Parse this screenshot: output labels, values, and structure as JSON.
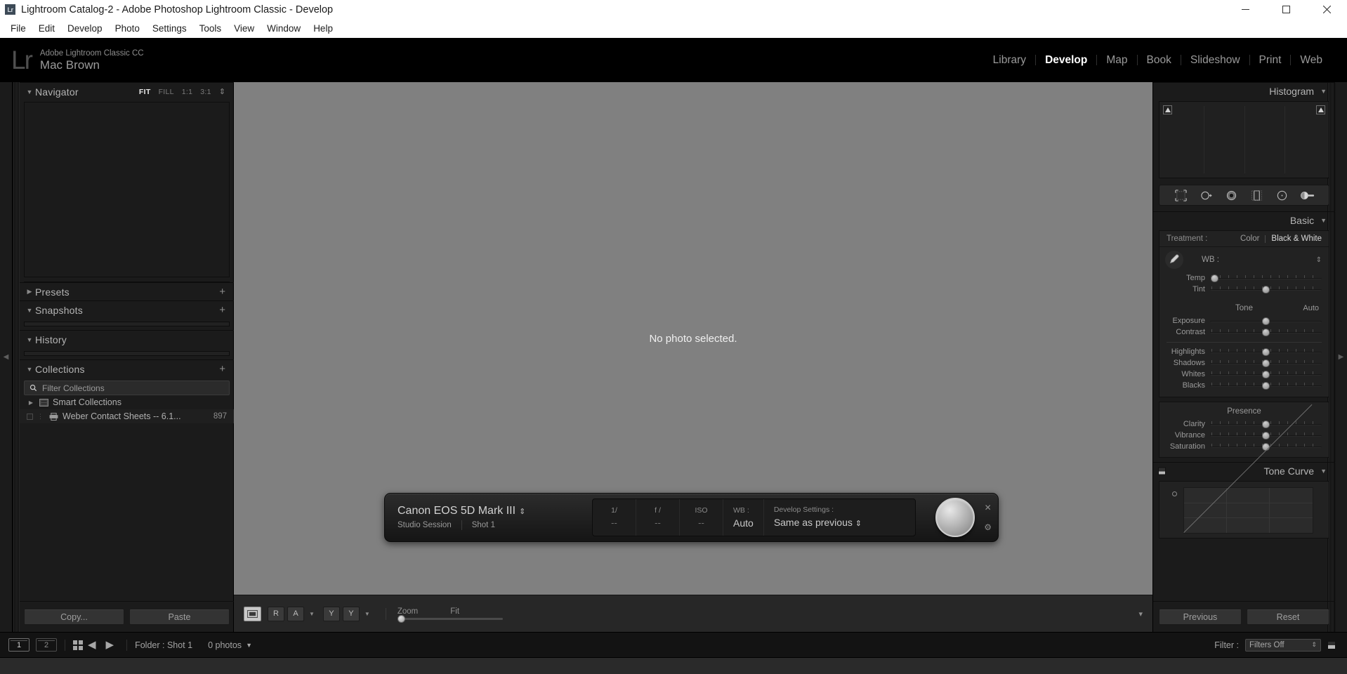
{
  "titlebar": {
    "icon": "lr-app-icon",
    "icon_text": "Lr",
    "title": "Lightroom Catalog-2 - Adobe Photoshop Lightroom Classic - Develop",
    "minimize": "minimize-icon",
    "maximize": "maximize-icon",
    "close": "close-icon"
  },
  "menubar": {
    "items": [
      {
        "label": "File"
      },
      {
        "label": "Edit"
      },
      {
        "label": "Develop"
      },
      {
        "label": "Photo"
      },
      {
        "label": "Settings"
      },
      {
        "label": "Tools"
      },
      {
        "label": "View"
      },
      {
        "label": "Window"
      },
      {
        "label": "Help"
      }
    ]
  },
  "identity": {
    "logo": "Lr",
    "product": "Adobe Lightroom Classic CC",
    "user": "Mac Brown"
  },
  "modules": [
    {
      "label": "Library",
      "active": false
    },
    {
      "label": "Develop",
      "active": true
    },
    {
      "label": "Map",
      "active": false
    },
    {
      "label": "Book",
      "active": false
    },
    {
      "label": "Slideshow",
      "active": false
    },
    {
      "label": "Print",
      "active": false
    },
    {
      "label": "Web",
      "active": false
    }
  ],
  "left_panel": {
    "navigator": {
      "title": "Navigator",
      "zoom_levels": [
        {
          "label": "FIT",
          "selected": true
        },
        {
          "label": "FILL",
          "selected": false
        },
        {
          "label": "1:1",
          "selected": false
        },
        {
          "label": "3:1",
          "selected": false
        }
      ]
    },
    "presets": {
      "title": "Presets",
      "expanded": false,
      "add": "+"
    },
    "snapshots": {
      "title": "Snapshots",
      "expanded": true,
      "add": "+"
    },
    "history": {
      "title": "History",
      "expanded": true
    },
    "collections": {
      "title": "Collections",
      "expanded": true,
      "add": "+",
      "filter_placeholder": "Filter Collections",
      "items": [
        {
          "label": "Smart Collections",
          "icon": "smart-collection-icon",
          "count": "",
          "expandable": true
        },
        {
          "label": "Weber Contact Sheets -- 6.1...",
          "icon": "print-collection-icon",
          "count": "897",
          "expandable": false
        }
      ]
    },
    "buttons": {
      "copy": "Copy...",
      "paste": "Paste"
    }
  },
  "center": {
    "empty_message": "No photo selected.",
    "tether": {
      "camera": "Canon EOS 5D Mark III",
      "session": "Studio Session",
      "shot": "Shot 1",
      "metadata": [
        {
          "key": "1/",
          "value": "--"
        },
        {
          "key": "f /",
          "value": "--"
        },
        {
          "key": "ISO",
          "value": "--"
        }
      ],
      "wb_key": "WB :",
      "wb_value": "Auto",
      "develop_key": "Develop Settings :",
      "develop_value": "Same as previous",
      "shutter": "shutter-button",
      "close": "close-icon",
      "settings": "gear-icon"
    },
    "toolbar": {
      "loupe": "loupe-view-icon",
      "compare_r": "R",
      "compare_a": "A",
      "before_y1": "Y",
      "before_y2": "Y",
      "zoom_label": "Zoom",
      "zoom_value": "Fit",
      "chevron": "chevron-down-icon"
    }
  },
  "right_panel": {
    "histogram": {
      "title": "Histogram"
    },
    "tools": [
      {
        "name": "crop-overlay-icon"
      },
      {
        "name": "spot-removal-icon"
      },
      {
        "name": "red-eye-correction-icon"
      },
      {
        "name": "graduated-filter-icon"
      },
      {
        "name": "radial-filter-icon"
      },
      {
        "name": "adjustment-brush-icon"
      }
    ],
    "basic": {
      "title": "Basic",
      "treatment_label": "Treatment :",
      "treatment_options": [
        {
          "label": "Color",
          "active": false
        },
        {
          "label": "Black & White",
          "active": true
        }
      ],
      "wb_label": "WB :",
      "wb_sliders": [
        {
          "label": "Temp",
          "position": 4
        },
        {
          "label": "Tint",
          "position": 50
        }
      ],
      "tone_label": "Tone",
      "auto_label": "Auto",
      "tone_sliders": [
        {
          "label": "Exposure",
          "position": 50
        },
        {
          "label": "Contrast",
          "position": 50
        },
        {
          "label": "Highlights",
          "position": 50
        },
        {
          "label": "Shadows",
          "position": 50
        },
        {
          "label": "Whites",
          "position": 50
        },
        {
          "label": "Blacks",
          "position": 50
        }
      ],
      "presence_label": "Presence",
      "presence_sliders": [
        {
          "label": "Clarity",
          "position": 50
        },
        {
          "label": "Vibrance",
          "position": 50
        },
        {
          "label": "Saturation",
          "position": 50
        }
      ]
    },
    "tone_curve": {
      "title": "Tone Curve"
    },
    "buttons": {
      "previous": "Previous",
      "reset": "Reset"
    }
  },
  "filmstrip_bar": {
    "screen1": "1",
    "screen2": "2",
    "grid": "grid-view-icon",
    "back": "back-arrow-icon",
    "forward": "forward-arrow-icon",
    "source": "Folder : Shot 1",
    "photo_count": "0 photos",
    "filter_label": "Filter :",
    "filter_value": "Filters Off"
  },
  "colors": {
    "panel_bg": "#1b1b1b",
    "canvas_bg": "#808080",
    "accent_text": "#b4b4b4",
    "active_module": "#ffffff"
  }
}
